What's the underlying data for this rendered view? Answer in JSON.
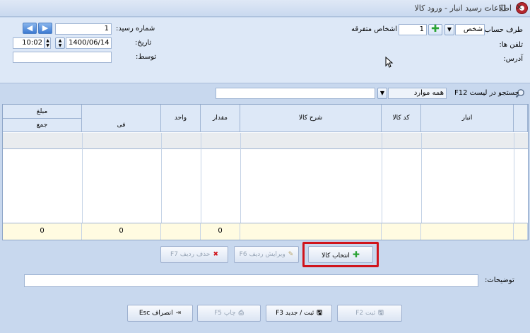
{
  "window": {
    "title": "اطلاعات رسید انبار - ورود کالا",
    "minimize": "–",
    "maximize": "□",
    "close": "✕"
  },
  "header": {
    "account_label": "طرف حساب:",
    "account_type": "شخص",
    "account_number": "1",
    "account_name": "اشخاص متفرقه",
    "phones_label": "تلفن ها:",
    "address_label": "آدرس:",
    "receipt_no_label": "شماره رسید:",
    "receipt_no": "1",
    "date_label": "تاریخ:",
    "date": "1400/06/14",
    "time": "10:02",
    "by_label": "توسط:",
    "by_value": ""
  },
  "search": {
    "label": "جستجو در لیست F12",
    "filter": "همه موارد",
    "value": ""
  },
  "grid": {
    "columns": {
      "warehouse": "انبار",
      "item_code": "کد کالا",
      "item_desc": "شرح کالا",
      "quantity": "مقدار",
      "unit": "واحد",
      "amount": "مبلغ",
      "unit_price": "فی",
      "total": "جمع"
    },
    "totals": {
      "quantity": "0",
      "unit_price": "0",
      "total": "0"
    }
  },
  "actions": {
    "select_item": "انتخاب کالا",
    "edit_row": "ویرایش ردیف F6",
    "delete_row": "حذف ردیف F7"
  },
  "notes": {
    "label": "توضیحات:",
    "value": ""
  },
  "footer": {
    "save": "ثبت F2",
    "save_new": "ثبت / جدید F3",
    "print": "چاپ F5",
    "cancel": "انصراف Esc"
  },
  "colors": {
    "accent_red": "#d0141c",
    "green_plus": "#2aa335",
    "totals_bg": "#fffbe1"
  }
}
